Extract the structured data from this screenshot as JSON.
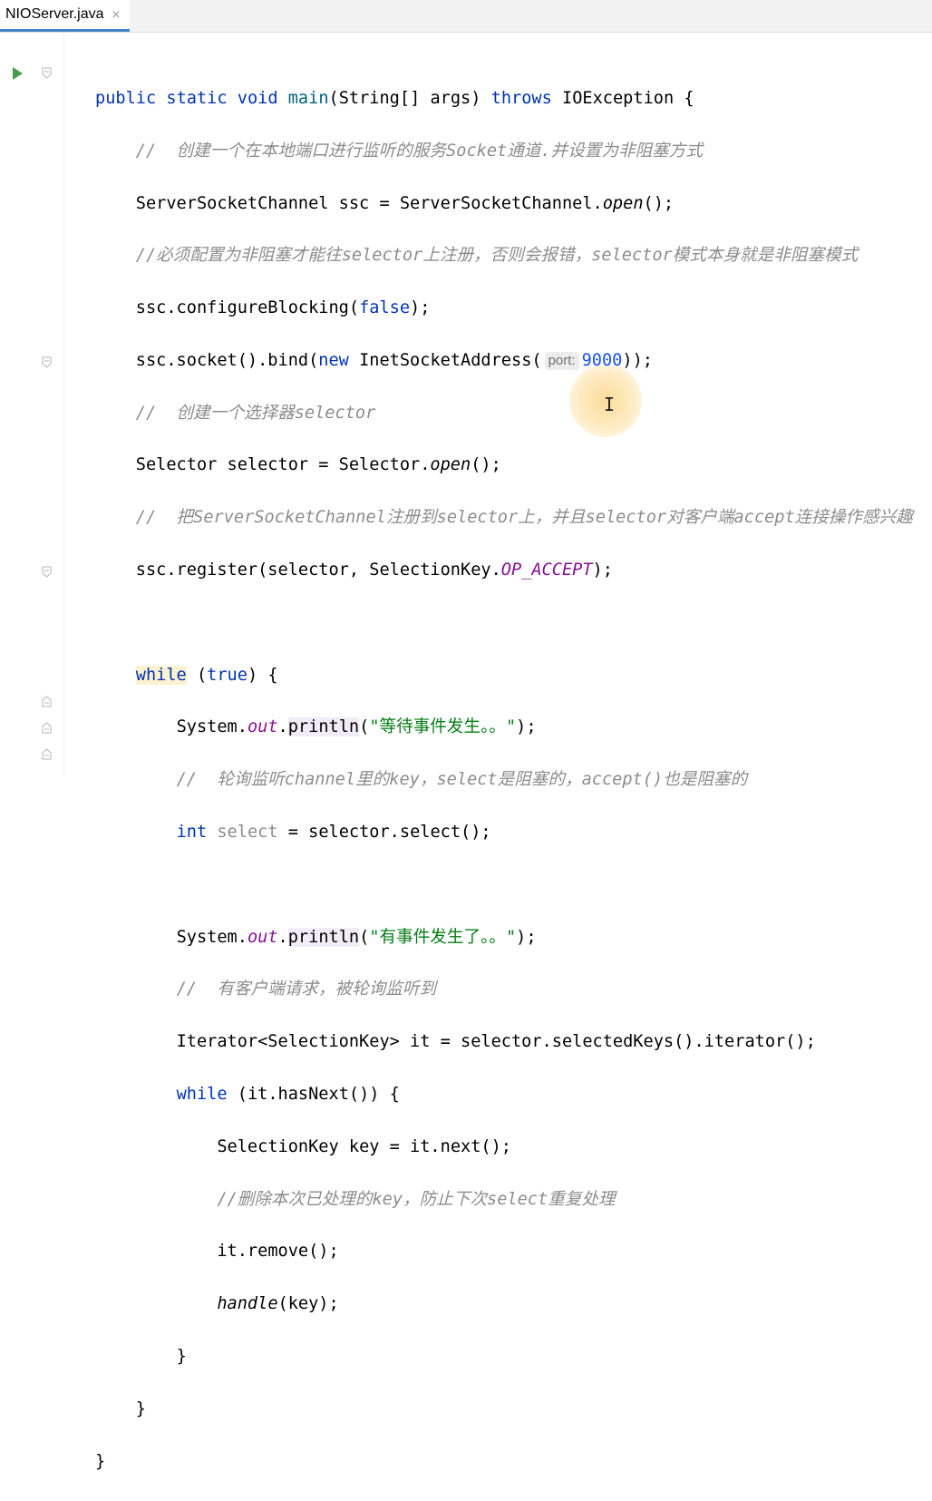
{
  "editor": {
    "tab": {
      "label": "NIOServer.java",
      "close": "×"
    },
    "icons": {
      "run": "run-triangle-icon",
      "fold": "fold-marker-icon",
      "cursor": "text-cursor-icon"
    },
    "colors": {
      "keyword": "#0033b3",
      "method": "#00627a",
      "comment": "#8c8c8c",
      "string": "#067d17",
      "number": "#1750eb",
      "field": "#871094",
      "active_tab_underline": "#4083c9",
      "run_icon": "#4a9b52"
    }
  },
  "code": {
    "l1": {
      "kw1": "public",
      "kw2": "static",
      "kw3": "void",
      "name": "main",
      "params": "(String[] args)",
      "kw4": "throws",
      "rest": "IOException {"
    },
    "l2": {
      "comment": "//  创建一个在本地端口进行监听的服务Socket通道.并设置为非阻塞方式"
    },
    "l3": {
      "a": "ServerSocketChannel ssc = ServerSocketChannel.",
      "m": "open",
      "b": "();"
    },
    "l4": {
      "comment": "//必须配置为非阻塞才能往selector上注册，否则会报错，selector模式本身就是非阻塞模式"
    },
    "l5": {
      "a": "ssc.configureBlocking(",
      "kw": "false",
      "b": ");"
    },
    "l6": {
      "a": "ssc.socket().bind(",
      "kw": "new",
      "b": "InetSocketAddress(",
      "hint": "port:",
      "num": "9000",
      "c": "));"
    },
    "l7": {
      "comment": "//  创建一个选择器selector"
    },
    "l8": {
      "a": "Selector selector = Selector.",
      "m": "open",
      "b": "();"
    },
    "l9": {
      "comment": "//  把ServerSocketChannel注册到selector上，并且selector对客户端accept连接操作感兴趣"
    },
    "l10": {
      "a": "ssc.register(selector, SelectionKey.",
      "f": "OP_ACCEPT",
      "b": ");"
    },
    "l12": {
      "kw": "while",
      "a": "(",
      "kw2": "true",
      "b": ") {"
    },
    "l13": {
      "a": "System.",
      "f": "out",
      "b": ".",
      "m": "println",
      "c": "(",
      "s": "\"等待事件发生。。\"",
      "d": ");"
    },
    "l14": {
      "comment": "//  轮询监听channel里的key，select是阻塞的，accept()也是阻塞的"
    },
    "l15": {
      "kw": "int",
      "v": "select",
      "a": "= selector.select();"
    },
    "l17": {
      "a": "System.",
      "f": "out",
      "b": ".",
      "m": "println",
      "c": "(",
      "s": "\"有事件发生了。。\"",
      "d": ");"
    },
    "l18": {
      "comment": "//  有客户端请求，被轮询监听到"
    },
    "l19": {
      "a": "Iterator<SelectionKey> it = selector.selectedKeys().iterator();"
    },
    "l20": {
      "kw": "while",
      "a": "(it.hasNext()) {"
    },
    "l21": {
      "a": "SelectionKey key = it.next();"
    },
    "l22": {
      "comment": "//删除本次已处理的key，防止下次select重复处理"
    },
    "l23": {
      "a": "it.remove();"
    },
    "l24": {
      "m": "handle",
      "a": "(key);"
    },
    "l25": {
      "a": "}"
    },
    "l26": {
      "a": "}"
    },
    "l27": {
      "a": "}"
    }
  }
}
